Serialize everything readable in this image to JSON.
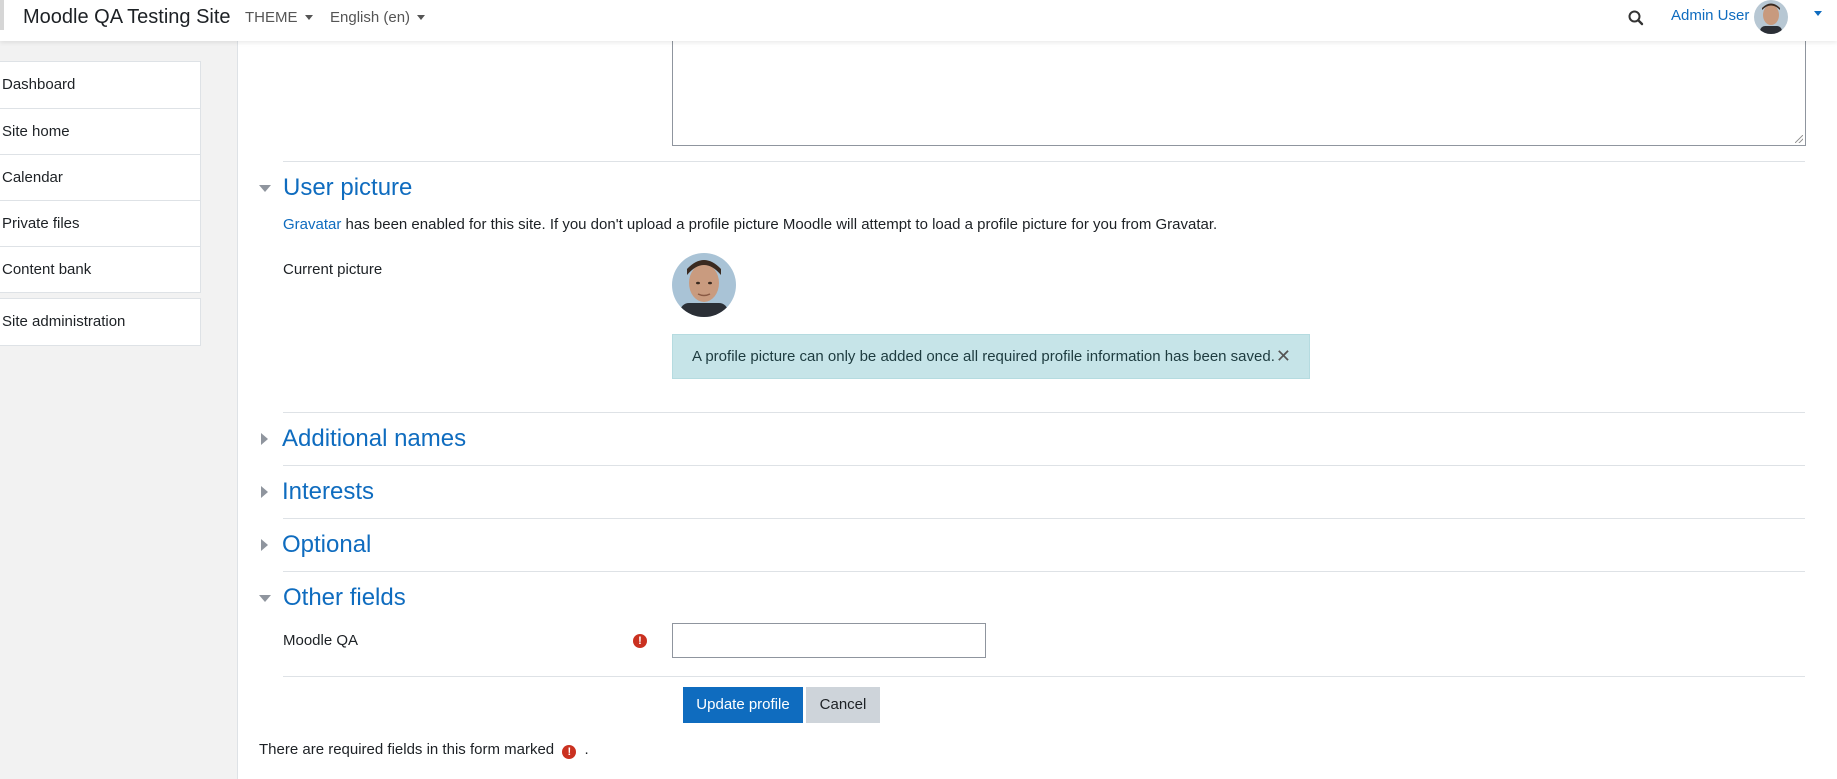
{
  "navbar": {
    "site_name": "Moodle QA Testing Site",
    "theme_label": "THEME",
    "language_label": "English (en)",
    "search_icon": "search-icon",
    "user_name": "Admin User",
    "accent_color": "#0f6cbf"
  },
  "sidebar": {
    "items": [
      {
        "label": "Dashboard"
      },
      {
        "label": "Site home"
      },
      {
        "label": "Calendar"
      },
      {
        "label": "Private files"
      },
      {
        "label": "Content bank"
      }
    ],
    "admin_item": {
      "label": "Site administration"
    }
  },
  "form": {
    "user_picture": {
      "title": "User picture",
      "gravatar_link": "Gravatar",
      "gravatar_text": " has been enabled for this site. If you don't upload a profile picture Moodle will attempt to load a profile picture for you from Gravatar.",
      "current_picture_label": "Current picture",
      "alert_text": "A profile picture can only be added once all required profile information has been saved.",
      "alert_close": "✕"
    },
    "additional_names": {
      "title": "Additional names"
    },
    "interests": {
      "title": "Interests"
    },
    "optional": {
      "title": "Optional"
    },
    "other_fields": {
      "title": "Other fields",
      "moodle_qa_label": "Moodle QA",
      "moodle_qa_value": ""
    },
    "required_icon_glyph": "!",
    "update_button": "Update profile",
    "cancel_button": "Cancel",
    "required_note_prefix": "There are required fields in this form marked",
    "required_note_suffix": "."
  }
}
